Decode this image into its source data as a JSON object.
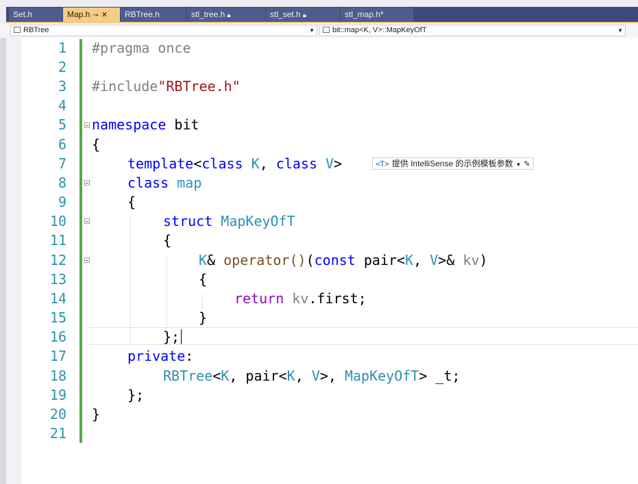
{
  "tabs": [
    {
      "label": "Set.h",
      "active": false,
      "locked": false
    },
    {
      "label": "Map.h",
      "active": true,
      "locked": false
    },
    {
      "label": "RBTree.h",
      "active": false,
      "locked": false
    },
    {
      "label": "stl_tree.h",
      "active": false,
      "locked": true
    },
    {
      "label": "stl_set.h",
      "active": false,
      "locked": true
    },
    {
      "label": "stl_map.h*",
      "active": false,
      "locked": false
    }
  ],
  "tab_icons": {
    "pin": "pin-icon",
    "close": "close-icon",
    "lock": "lock-icon"
  },
  "nav": {
    "scope": "RBTree",
    "member": "bit::map<K, V>::MapKeyOfT"
  },
  "hint": {
    "tag": "<T>",
    "text": "提供 IntelliSense 的示例模板参数"
  },
  "line_numbers": [
    "1",
    "2",
    "3",
    "4",
    "5",
    "6",
    "7",
    "8",
    "9",
    "10",
    "11",
    "12",
    "13",
    "14",
    "15",
    "16",
    "17",
    "18",
    "19",
    "20",
    "21"
  ],
  "code": {
    "l1": "#pragma once",
    "l3a": "#include",
    "l3b": "\"RBTree.h\"",
    "l5a": "namespace",
    "l5b": " bit",
    "l6": "{",
    "l7a": "template",
    "l7b": "<",
    "l7c": "class",
    "l7d": " K",
    "l7e": ", ",
    "l7f": "class",
    "l7g": " V",
    "l7h": ">",
    "l8a": "class",
    "l8b": " map",
    "l9": "{",
    "l10a": "struct",
    "l10b": " MapKeyOfT",
    "l11": "{",
    "l12a": "K",
    "l12b": "& ",
    "l12c": "operator()",
    "l12d": "(",
    "l12e": "const",
    "l12f": " pair",
    "l12g": "<",
    "l12h": "K",
    "l12i": ", ",
    "l12j": "V",
    "l12k": ">& ",
    "l12l": "kv",
    "l12m": ")",
    "l13": "{",
    "l14a": "return",
    "l14b": " kv",
    "l14c": ".first;",
    "l15": "}",
    "l16": "};",
    "l17a": "private",
    "l17b": ":",
    "l18a": "RBTree",
    "l18b": "<",
    "l18c": "K",
    "l18d": ", pair<",
    "l18e": "K",
    "l18f": ", ",
    "l18g": "V",
    "l18h": ">, ",
    "l18i": "MapKeyOfT",
    "l18j": "> _t;",
    "l19": "};",
    "l20": "}"
  },
  "colors": {
    "keyword": "#0000ff",
    "preprocessor": "#808080",
    "string": "#a31515",
    "type": "#2b91af",
    "function": "#74531f",
    "control": "#8f08c4",
    "line_number": "#2b91af",
    "change_bar": "#57a64a",
    "active_tab": "#f5cc84"
  }
}
